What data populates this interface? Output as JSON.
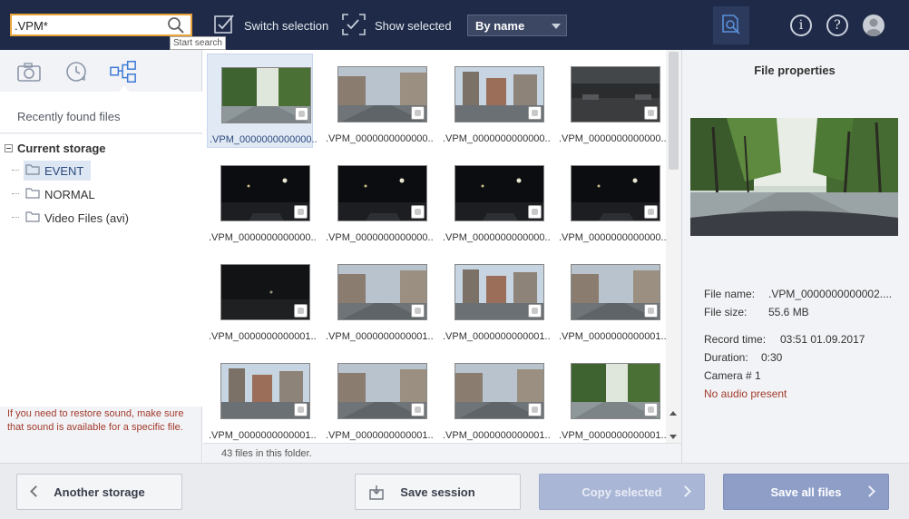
{
  "toolbar": {
    "search_value": ".VPM*",
    "search_tooltip": "Start search",
    "switch_selection_label": "Switch selection",
    "show_selected_label": "Show selected",
    "sort_value": "By name",
    "info_label": "i",
    "help_label": "?"
  },
  "sidebar": {
    "recently_found": "Recently found files",
    "tree_root": "Current storage",
    "items": [
      {
        "label": "EVENT",
        "selected": true
      },
      {
        "label": "NORMAL",
        "selected": false
      },
      {
        "label": "Video Files (avi)",
        "selected": false
      }
    ],
    "hint": "If you need to restore sound, make sure that sound is available for a specific file."
  },
  "files": {
    "tiles": [
      {
        "name": ".VPM_0000000000000...",
        "scene": "park",
        "selected": true
      },
      {
        "name": ".VPM_0000000000000...",
        "scene": "street",
        "selected": false
      },
      {
        "name": ".VPM_0000000000000...",
        "scene": "city",
        "selected": false
      },
      {
        "name": ".VPM_0000000000000...",
        "scene": "garage",
        "selected": false
      },
      {
        "name": ".VPM_0000000000000...",
        "scene": "night",
        "selected": false
      },
      {
        "name": ".VPM_0000000000000...",
        "scene": "night",
        "selected": false
      },
      {
        "name": ".VPM_0000000000000...",
        "scene": "night",
        "selected": false
      },
      {
        "name": ".VPM_0000000000000...",
        "scene": "night",
        "selected": false
      },
      {
        "name": ".VPM_0000000000001...",
        "scene": "dark",
        "selected": false
      },
      {
        "name": ".VPM_0000000000001...",
        "scene": "street",
        "selected": false
      },
      {
        "name": ".VPM_0000000000001...",
        "scene": "city",
        "selected": false
      },
      {
        "name": ".VPM_0000000000001...",
        "scene": "street",
        "selected": false
      },
      {
        "name": ".VPM_0000000000001...",
        "scene": "city",
        "selected": false
      },
      {
        "name": ".VPM_0000000000001...",
        "scene": "street",
        "selected": false
      },
      {
        "name": ".VPM_0000000000001...",
        "scene": "street",
        "selected": false
      },
      {
        "name": ".VPM_0000000000001...",
        "scene": "park",
        "selected": false
      }
    ],
    "status": "43 files in this folder."
  },
  "properties": {
    "title": "File properties",
    "file_name_label": "File name:",
    "file_name_value": ".VPM_0000000000002....",
    "file_size_label": "File size:",
    "file_size_value": "55.6 MB",
    "record_time_label": "Record time:",
    "record_time_value": "03:51 01.09.2017",
    "duration_label": "Duration:",
    "duration_value": "0:30",
    "camera_label": "Camera # 1",
    "audio_label": "No audio present"
  },
  "bottom": {
    "another_storage": "Another storage",
    "save_session": "Save session",
    "copy_selected": "Copy selected",
    "save_all": "Save all files"
  },
  "colors": {
    "topbar": "#1e2a47",
    "search_border": "#e8a33a",
    "selection": "#e1e9f5",
    "hint_text": "#a23b2c",
    "button_blue": "#8e9ec7"
  }
}
